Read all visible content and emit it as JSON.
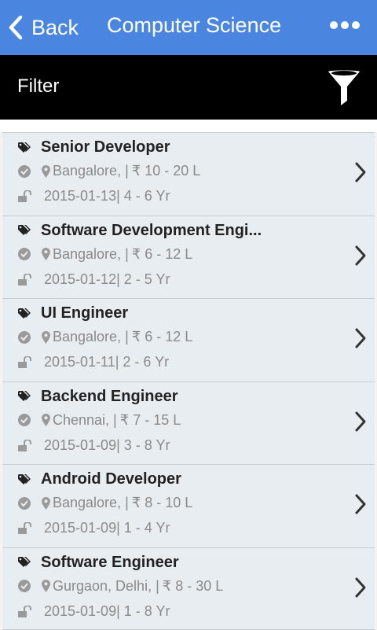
{
  "header": {
    "back_label": "Back",
    "title": "Computer Science",
    "accent": "#4a86e0"
  },
  "filter": {
    "label": "Filter"
  },
  "jobs": [
    {
      "title": "Senior Developer",
      "location": "Bangalore, |",
      "salary": "₹ 10 - 20 L",
      "date_exp": "2015-01-13| 4 - 6 Yr"
    },
    {
      "title": "Software Development Engi...",
      "location": "Bangalore, |",
      "salary": "₹ 6 - 12 L",
      "date_exp": "2015-01-12| 2 - 5 Yr"
    },
    {
      "title": "UI Engineer",
      "location": "Bangalore, |",
      "salary": "₹ 6 - 12 L",
      "date_exp": "2015-01-11| 2 - 6 Yr"
    },
    {
      "title": "Backend Engineer",
      "location": "Chennai, |",
      "salary": "₹ 7 - 15 L",
      "date_exp": "2015-01-09| 3 - 8 Yr"
    },
    {
      "title": "Android Developer",
      "location": "Bangalore, |",
      "salary": "₹ 8 - 10 L",
      "date_exp": "2015-01-09| 1 - 4 Yr"
    },
    {
      "title": "Software Engineer",
      "location": "Gurgaon, Delhi, |",
      "salary": "₹ 8 - 30 L",
      "date_exp": "2015-01-09| 1 - 8 Yr"
    }
  ]
}
